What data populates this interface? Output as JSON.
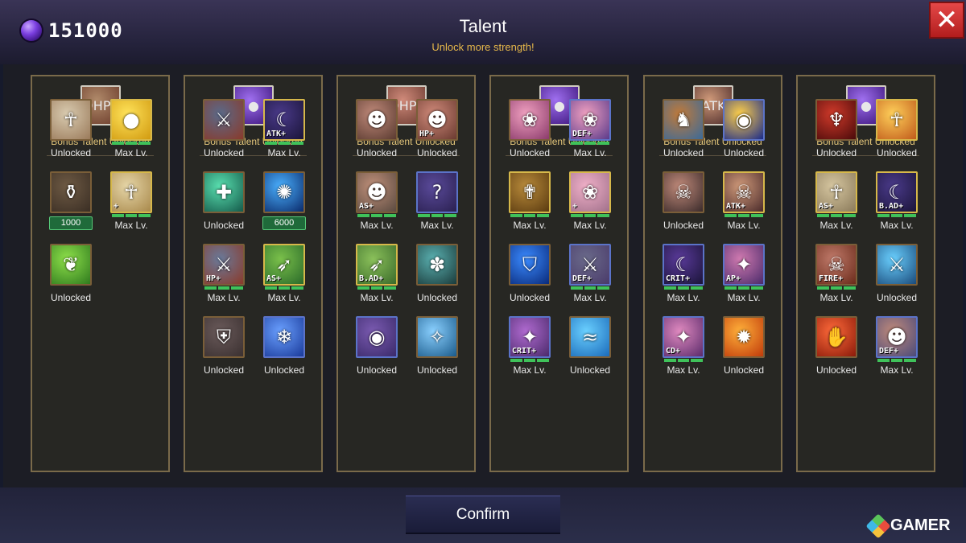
{
  "header": {
    "currency_value": "151000",
    "title": "Talent",
    "subtitle": "Unlock more strength!"
  },
  "footer": {
    "confirm_label": "Confirm",
    "watermark": "GAMER"
  },
  "colors": {
    "gold_text": "#e4c67a",
    "subtitle": "#e6b84a",
    "level_bar": "#3fc25a",
    "close_red": "#d33a3a"
  },
  "columns": [
    {
      "bonus_icon": "hero-hp-icon",
      "bonus_tag": "HP+",
      "bonus_label": "Bonus Talent Unlocked",
      "talents": [
        {
          "icon": "priestess-icon",
          "tag": "",
          "label": "Unlocked"
        },
        {
          "icon": "gold-coin-icon",
          "tag": "",
          "label": "Max Lv."
        },
        {
          "icon": "potion-flask-icon",
          "tag": "",
          "label": "",
          "cost": "1000"
        },
        {
          "icon": "priestess-heal-icon",
          "tag": "+",
          "label": "Max Lv."
        },
        {
          "icon": "leaf-icon",
          "tag": "",
          "label": "Unlocked"
        }
      ]
    },
    {
      "bonus_icon": "purple-gem-icon",
      "bonus_tag": "",
      "bonus_label": "Bonus Talent Unlocked",
      "talents": [
        {
          "icon": "knight-icon",
          "tag": "",
          "label": "Unlocked"
        },
        {
          "icon": "dark-mage-icon",
          "tag": "ATK+",
          "label": "Max Lv."
        },
        {
          "icon": "heal-cross-icon",
          "tag": "",
          "label": "Unlocked"
        },
        {
          "icon": "vortex-icon",
          "tag": "",
          "label": "",
          "cost": "6000"
        },
        {
          "icon": "knight-hp-icon",
          "tag": "HP+",
          "label": "Max Lv."
        },
        {
          "icon": "elf-archer-icon",
          "tag": "AS+",
          "label": "Max Lv."
        },
        {
          "icon": "knight-shield-icon",
          "tag": "",
          "label": "Unlocked"
        },
        {
          "icon": "snowflake-icon",
          "tag": "",
          "label": "Unlocked"
        }
      ]
    },
    {
      "bonus_icon": "dwarf-hp-icon",
      "bonus_tag": "HP+",
      "bonus_label": "Bonus Talent Unlocked",
      "talents": [
        {
          "icon": "dwarf-icon",
          "tag": "",
          "label": "Unlocked"
        },
        {
          "icon": "dwarf-hp-icon",
          "tag": "HP+",
          "label": "Unlocked"
        },
        {
          "icon": "dwarf-as-icon",
          "tag": "AS+",
          "label": "Max Lv."
        },
        {
          "icon": "mystery-icon",
          "tag": "",
          "label": "Max Lv."
        },
        {
          "icon": "elf-ad-icon",
          "tag": "B.AD+",
          "label": "Max Lv."
        },
        {
          "icon": "whirlwind-icon",
          "tag": "",
          "label": "Unlocked"
        },
        {
          "icon": "seal-icon",
          "tag": "",
          "label": "Unlocked"
        },
        {
          "icon": "ice-shard-icon",
          "tag": "",
          "label": "Unlocked"
        }
      ]
    },
    {
      "bonus_icon": "purple-gem-icon",
      "bonus_tag": "",
      "bonus_label": "Bonus Talent Unlocked",
      "talents": [
        {
          "icon": "pink-girl-icon",
          "tag": "",
          "label": "Unlocked"
        },
        {
          "icon": "pink-girl-def-icon",
          "tag": "DEF+",
          "label": "Max Lv."
        },
        {
          "icon": "holy-book-icon",
          "tag": "",
          "label": "Max Lv."
        },
        {
          "icon": "pink-girl-heal-icon",
          "tag": "+",
          "label": "Max Lv."
        },
        {
          "icon": "blue-shield-icon",
          "tag": "",
          "label": "Unlocked"
        },
        {
          "icon": "knight-def-icon",
          "tag": "DEF+",
          "label": "Max Lv."
        },
        {
          "icon": "witch-crit-icon",
          "tag": "CRIT+",
          "label": "Max Lv."
        },
        {
          "icon": "water-wave-icon",
          "tag": "",
          "label": "Unlocked"
        }
      ]
    },
    {
      "bonus_icon": "pirate-atk-icon",
      "bonus_tag": "ATK+",
      "bonus_label": "Bonus Talent Unlocked",
      "talents": [
        {
          "icon": "dragon-icon",
          "tag": "",
          "label": "Unlocked"
        },
        {
          "icon": "dragon-eye-icon",
          "tag": "",
          "label": "Unlocked"
        },
        {
          "icon": "pirate-icon",
          "tag": "",
          "label": "Unlocked"
        },
        {
          "icon": "pirate-atk-icon",
          "tag": "ATK+",
          "label": "Max Lv."
        },
        {
          "icon": "dark-mage-crit-icon",
          "tag": "CRIT+",
          "label": "Max Lv."
        },
        {
          "icon": "witch-ap-icon",
          "tag": "AP+",
          "label": "Max Lv."
        },
        {
          "icon": "witch-cd-icon",
          "tag": "CD+",
          "label": "Max Lv."
        },
        {
          "icon": "fireball-icon",
          "tag": "",
          "label": "Unlocked"
        }
      ]
    },
    {
      "bonus_icon": "purple-gem-icon",
      "bonus_tag": "",
      "bonus_label": "Bonus Talent Unlocked",
      "talents": [
        {
          "icon": "demon-icon",
          "tag": "",
          "label": "Unlocked"
        },
        {
          "icon": "fire-priestess-icon",
          "tag": "",
          "label": "Unlocked"
        },
        {
          "icon": "priestess-as-icon",
          "tag": "AS+",
          "label": "Max Lv."
        },
        {
          "icon": "dark-mage-ad-icon",
          "tag": "B.AD+",
          "label": "Max Lv."
        },
        {
          "icon": "pirate-fire-icon",
          "tag": "FIRE+",
          "label": "Max Lv."
        },
        {
          "icon": "sword-slash-icon",
          "tag": "",
          "label": "Unlocked"
        },
        {
          "icon": "fire-claw-icon",
          "tag": "",
          "label": "Unlocked"
        },
        {
          "icon": "dwarf-def-icon",
          "tag": "DEF+",
          "label": "Max Lv."
        }
      ]
    }
  ]
}
